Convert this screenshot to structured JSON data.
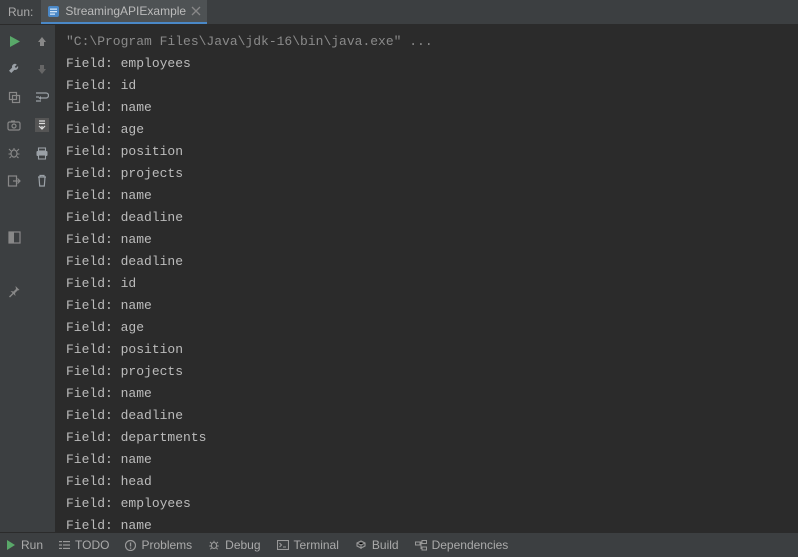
{
  "header": {
    "run_label": "Run:",
    "tab": {
      "title": "StreamingAPIExample",
      "icon": "list-icon",
      "close": "×"
    }
  },
  "colors": {
    "bg": "#3c3f41",
    "console_bg": "#2b2b2b",
    "accent": "#4a88c7",
    "run_green": "#59a869",
    "text": "#bbbbbb"
  },
  "toolbar_col1": [
    {
      "name": "run-icon"
    },
    {
      "name": "wrench-icon"
    },
    {
      "name": "duplicate-icon"
    },
    {
      "name": "camera-icon"
    },
    {
      "name": "bug-icon"
    },
    {
      "name": "exit-icon"
    },
    {
      "name": "layout-icon"
    },
    {
      "name": "pin-icon"
    }
  ],
  "toolbar_col2": [
    {
      "name": "arrow-up-icon"
    },
    {
      "name": "arrow-down-icon"
    },
    {
      "name": "soft-wrap-icon"
    },
    {
      "name": "scroll-end-icon"
    },
    {
      "name": "print-icon"
    },
    {
      "name": "trash-icon"
    }
  ],
  "console": {
    "command": "\"C:\\Program Files\\Java\\jdk-16\\bin\\java.exe\" ...",
    "lines": [
      "Field: employees",
      "Field: id",
      "Field: name",
      "Field: age",
      "Field: position",
      "Field: projects",
      "Field: name",
      "Field: deadline",
      "Field: name",
      "Field: deadline",
      "Field: id",
      "Field: name",
      "Field: age",
      "Field: position",
      "Field: projects",
      "Field: name",
      "Field: deadline",
      "Field: departments",
      "Field: name",
      "Field: head",
      "Field: employees",
      "Field: name"
    ]
  },
  "bottom": {
    "run": "Run",
    "todo": "TODO",
    "problems": "Problems",
    "debug": "Debug",
    "terminal": "Terminal",
    "build": "Build",
    "dependencies": "Dependencies"
  }
}
